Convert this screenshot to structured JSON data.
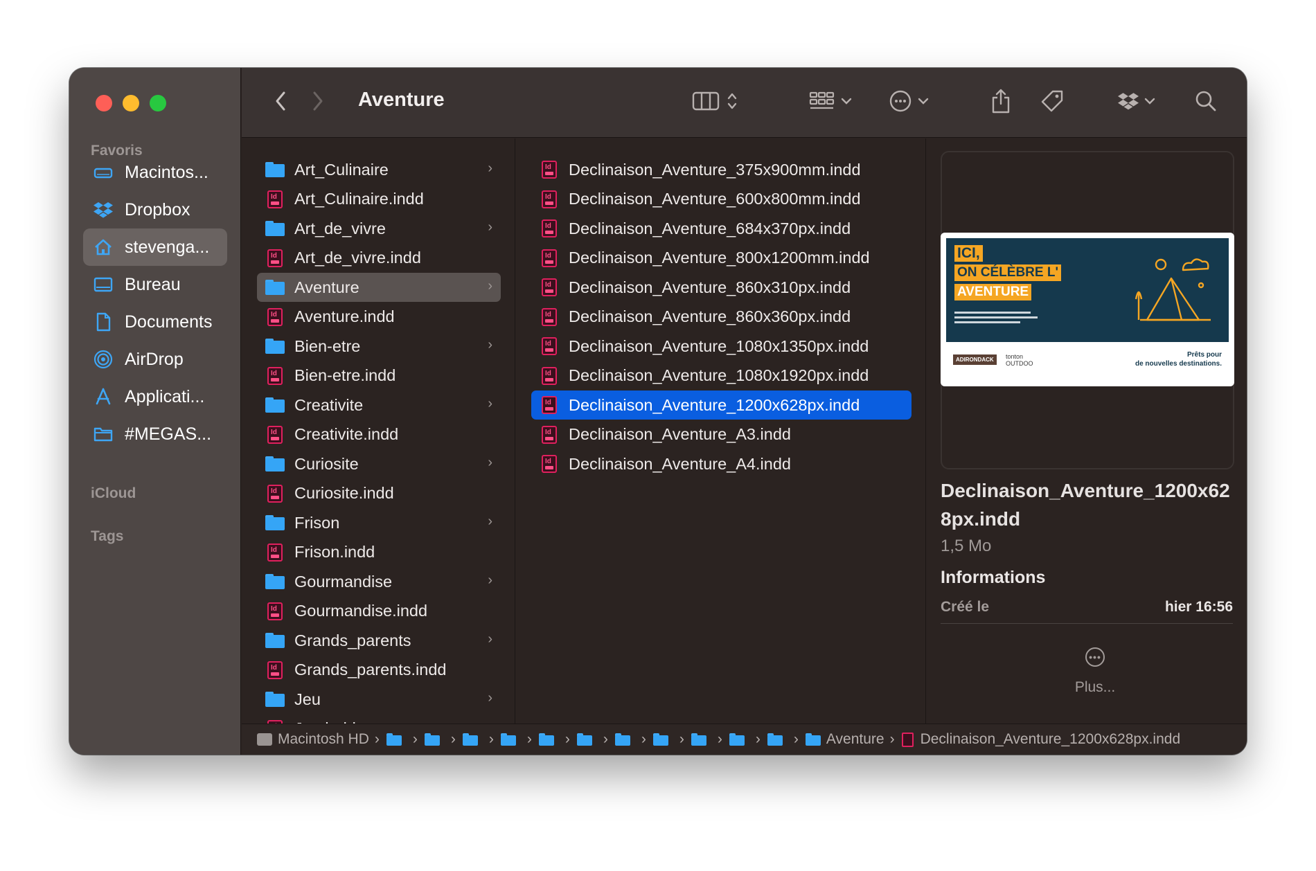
{
  "window": {
    "title": "Aventure"
  },
  "sidebar": {
    "favorites_label": "Favoris",
    "items": [
      {
        "label": "Macintos...",
        "icon": "hard-drive-icon"
      },
      {
        "label": "Dropbox",
        "icon": "dropbox-icon"
      },
      {
        "label": "stevenga...",
        "icon": "home-icon"
      },
      {
        "label": "Bureau",
        "icon": "desktop-icon"
      },
      {
        "label": "Documents",
        "icon": "document-icon"
      },
      {
        "label": "AirDrop",
        "icon": "airdrop-icon"
      },
      {
        "label": "Applicati...",
        "icon": "applications-icon"
      },
      {
        "label": "#MEGAS...",
        "icon": "folder-icon"
      }
    ],
    "icloud_label": "iCloud",
    "tags_label": "Tags"
  },
  "column1": [
    {
      "name": "Art_Culinaire",
      "type": "folder"
    },
    {
      "name": "Art_Culinaire.indd",
      "type": "indd"
    },
    {
      "name": "Art_de_vivre",
      "type": "folder"
    },
    {
      "name": "Art_de_vivre.indd",
      "type": "indd"
    },
    {
      "name": "Aventure",
      "type": "folder"
    },
    {
      "name": "Aventure.indd",
      "type": "indd"
    },
    {
      "name": "Bien-etre",
      "type": "folder"
    },
    {
      "name": "Bien-etre.indd",
      "type": "indd"
    },
    {
      "name": "Creativite",
      "type": "folder"
    },
    {
      "name": "Creativite.indd",
      "type": "indd"
    },
    {
      "name": "Curiosite",
      "type": "folder"
    },
    {
      "name": "Curiosite.indd",
      "type": "indd"
    },
    {
      "name": "Frison",
      "type": "folder"
    },
    {
      "name": "Frison.indd",
      "type": "indd"
    },
    {
      "name": "Gourmandise",
      "type": "folder"
    },
    {
      "name": "Gourmandise.indd",
      "type": "indd"
    },
    {
      "name": "Grands_parents",
      "type": "folder"
    },
    {
      "name": "Grands_parents.indd",
      "type": "indd"
    },
    {
      "name": "Jeu",
      "type": "folder"
    },
    {
      "name": "Jeu.indd",
      "type": "indd"
    }
  ],
  "column2": [
    "Declinaison_Aventure_375x900mm.indd",
    "Declinaison_Aventure_600x800mm.indd",
    "Declinaison_Aventure_684x370px.indd",
    "Declinaison_Aventure_800x1200mm.indd",
    "Declinaison_Aventure_860x310px.indd",
    "Declinaison_Aventure_860x360px.indd",
    "Declinaison_Aventure_1080x1350px.indd",
    "Declinaison_Aventure_1080x1920px.indd",
    "Declinaison_Aventure_1200x628px.indd",
    "Declinaison_Aventure_A3.indd",
    "Declinaison_Aventure_A4.indd"
  ],
  "preview": {
    "filename": "Declinaison_Aventure_1200x628px.indd",
    "size": "1,5 Mo",
    "info_heading": "Informations",
    "created_label": "Créé le",
    "created_value": "hier 16:56",
    "more_label": "Plus...",
    "thumb": {
      "line1": "ICI,",
      "line2": "ON CÉLÈBRE L'",
      "line3": "AVENTURE",
      "tagline1": "Prêts pour",
      "tagline2": "de nouvelles destinations.",
      "brand1": "ADIRONDACK",
      "brand2": "tonton OUTDOO"
    }
  },
  "pathbar": {
    "root": "Macintosh HD",
    "folder": "Aventure",
    "file": "Declinaison_Aventure_1200x628px.indd"
  },
  "colors": {
    "selection": "#0a5ee0",
    "folder": "#35a5f6",
    "indd": "#e0205e"
  }
}
